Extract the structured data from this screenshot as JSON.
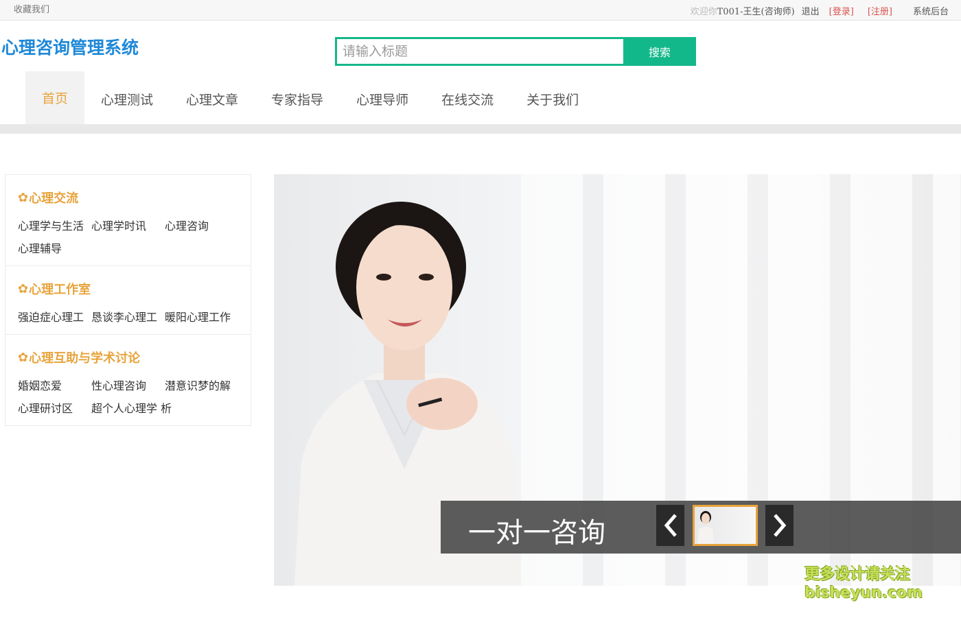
{
  "topbar": {
    "favorite": "收藏我们",
    "welcome": "欢迎你",
    "user": "T001-王生(咨询师)",
    "logout": "退出",
    "login": "[登录]",
    "register": "[注册]",
    "admin": "系统后台"
  },
  "header": {
    "logo": "心理咨询管理系统",
    "search_placeholder": "请输入标题",
    "search_button": "搜索"
  },
  "nav": {
    "items": [
      "首页",
      "心理测试",
      "心理文章",
      "专家指导",
      "心理导师",
      "在线交流",
      "关于我们"
    ],
    "active_index": 0
  },
  "sidebar": {
    "groups": [
      {
        "title": "心理交流",
        "links": [
          "心理学与生活",
          "心理学时讯",
          "心理咨询",
          "心理辅导"
        ]
      },
      {
        "title": "心理工作室",
        "links": [
          "强迫症心理工",
          "恳谈李心理工",
          "暖阳心理工作"
        ]
      },
      {
        "title": "心理互助与学术讨论",
        "links": [
          "婚姻恋爱",
          "性心理咨询",
          "潜意识梦的解",
          "心理研讨区",
          "超个人心理学 析"
        ]
      }
    ]
  },
  "banner": {
    "caption": "一对一咨询"
  },
  "watermark": {
    "line1": "更多设计请关注",
    "line2": "bisheyun.com"
  },
  "colors": {
    "accent": "#e8a33b",
    "brand": "#1e88d8",
    "search": "#13b88a"
  }
}
